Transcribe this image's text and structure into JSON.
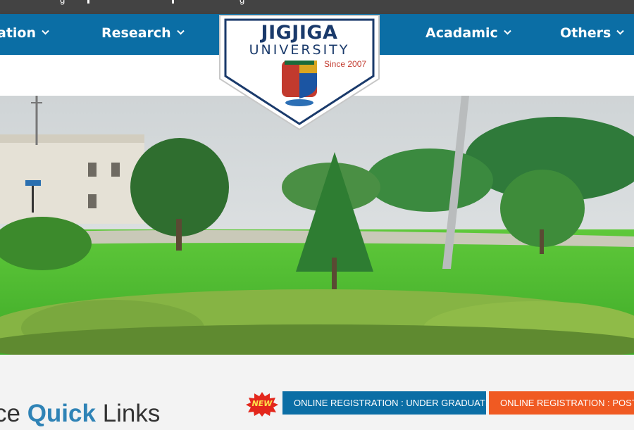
{
  "topbar": {
    "fragment_1": "g",
    "fragment_2": "g"
  },
  "nav": {
    "items": [
      {
        "label": "ation"
      },
      {
        "label": "Research"
      },
      {
        "label": "Acadamic"
      },
      {
        "label": "Others"
      }
    ]
  },
  "logo": {
    "name_line1": "JIGJIGA",
    "name_line2": "UNIVERSITY",
    "since": "Since 2007"
  },
  "hero": {
    "alt": "campus garden photo"
  },
  "quick_links": {
    "new_badge": "NEW",
    "heading_prefix": "ce ",
    "heading_bold": "Quick",
    "heading_suffix": " Links",
    "btn_undergraduate": "ONLINE REGISTRATION : UNDER GRADUATE",
    "btn_postgraduate": "ONLINE REGISTRATION : POST G"
  },
  "colors": {
    "nav_blue": "#0b6ea5",
    "topbar": "#434343",
    "post_orange": "#f05a22",
    "heading_blue": "#2f83b6"
  }
}
